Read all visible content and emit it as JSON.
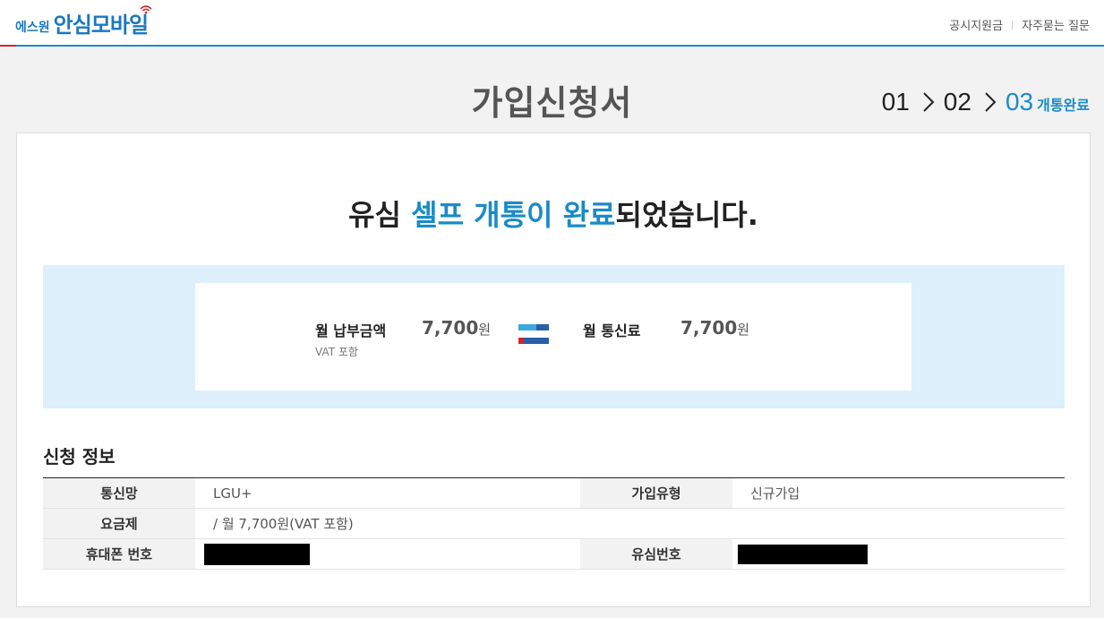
{
  "header": {
    "logo_sub": "에스원",
    "logo_main": "안심모바일",
    "links": [
      "공시지원금",
      "자주묻는 질문"
    ]
  },
  "page_title": "가입신청서",
  "steps": {
    "items": [
      "01",
      "02",
      "03"
    ],
    "active_label": "개통완료"
  },
  "message": {
    "prefix": "유심 ",
    "highlight": "셀프 개통이 완료",
    "suffix": "되었습니다."
  },
  "summary": {
    "left_label": "월 납부금액",
    "left_sub": "VAT 포함",
    "left_value": "7,700",
    "right_label": "월 통신료",
    "right_value": "7,700",
    "unit": "원"
  },
  "section_title": "신청 정보",
  "info": {
    "network_label": "통신망",
    "network_value": "LGU+",
    "join_type_label": "가입유형",
    "join_type_value": "신규가입",
    "plan_label": "요금제",
    "plan_value": "/ 월 7,700원(VAT 포함)",
    "phone_label": "휴대폰 번호",
    "usim_label": "유심번호"
  },
  "colors": {
    "accent": "#1a8bc7",
    "brand_red": "#d8232a",
    "band": "#ddf0fb"
  }
}
